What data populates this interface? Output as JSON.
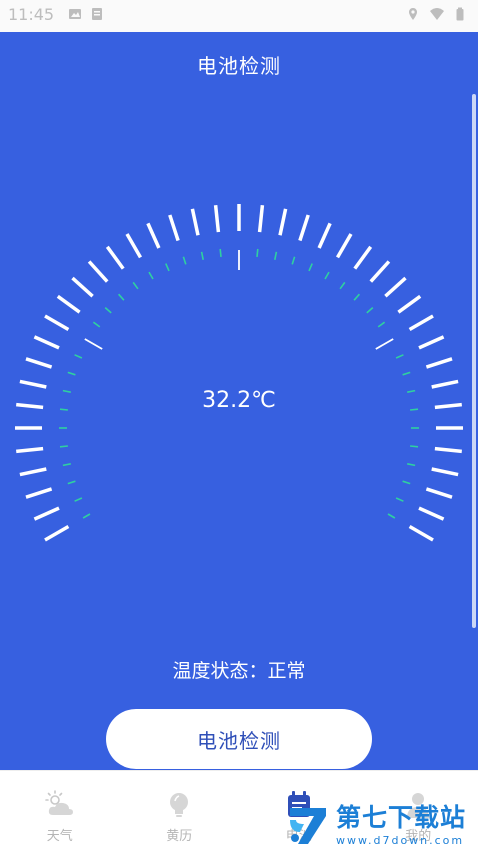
{
  "status_bar": {
    "time": "11:45",
    "left_icons": [
      "image-notification-icon",
      "app-notification-icon"
    ],
    "right_icons": [
      "location-icon",
      "wifi-icon",
      "battery-icon"
    ]
  },
  "header": {
    "title": "电池检测"
  },
  "gauge": {
    "temperature": "32.2℃",
    "value": 32.2,
    "outer_tick_count": 41,
    "inner_tick_count": 41,
    "colors": {
      "outer_tick": "#ffffff",
      "inner_tick": "#2fd0a0",
      "background": "#3760e0"
    }
  },
  "status": {
    "text": "温度状态：正常"
  },
  "actions": {
    "check_button": "电池检测"
  },
  "tab_bar": {
    "tabs": [
      {
        "label": "天气",
        "icon": "weather-icon"
      },
      {
        "label": "黄历",
        "icon": "lightbulb-icon"
      },
      {
        "label": "电池",
        "icon": "battery-tab-icon",
        "active": true
      },
      {
        "label": "我的",
        "icon": "profile-icon"
      }
    ]
  },
  "watermark": {
    "title": "第七下载站",
    "url": "www.d7down.com"
  }
}
